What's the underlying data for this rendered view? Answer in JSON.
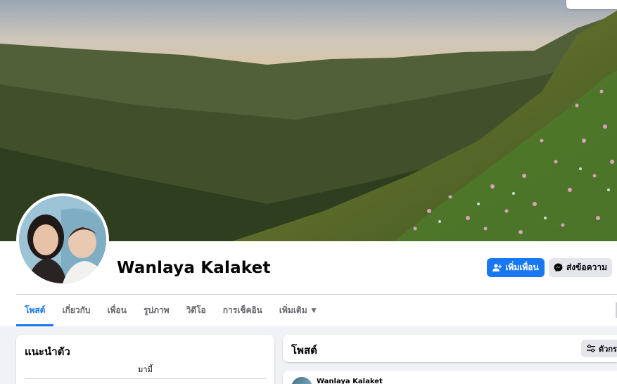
{
  "profile": {
    "name": "Wanlaya Kalaket",
    "add_friend_label": "เพิ่มเพื่อน",
    "message_label": "ส่งข้อความ"
  },
  "tabs": [
    {
      "label": "โพสต์",
      "active": true
    },
    {
      "label": "เกี่ยวกับ",
      "active": false
    },
    {
      "label": "เพื่อน",
      "active": false
    },
    {
      "label": "รูปภาพ",
      "active": false
    },
    {
      "label": "วิดีโอ",
      "active": false
    },
    {
      "label": "การเช็คอิน",
      "active": false
    },
    {
      "label": "เพิ่มเติม",
      "active": false
    }
  ],
  "intro_card": {
    "title": "แนะนำตัว",
    "text": "มามี้"
  },
  "posts_card": {
    "title": "โพสต์",
    "filter_label": "ตัวกร"
  },
  "post": {
    "author": "Wanlaya Kalaket"
  },
  "colors": {
    "accent": "#1877f2",
    "secondary_button": "#e4e6eb",
    "page_bg": "#f0f2f5"
  }
}
